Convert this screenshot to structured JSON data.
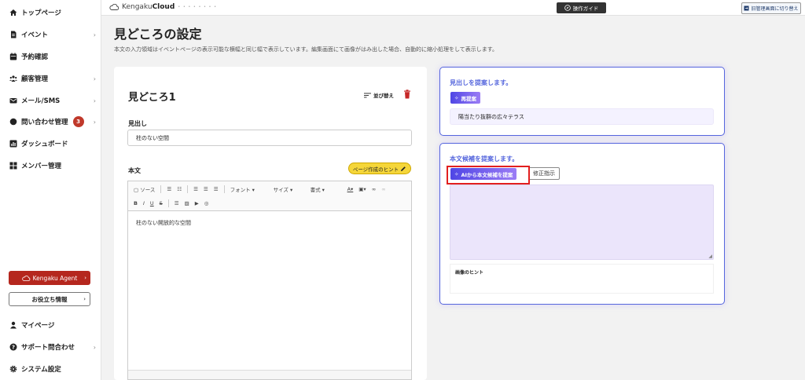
{
  "sidebar": {
    "items": [
      {
        "label": "トップページ",
        "icon": "home-icon"
      },
      {
        "label": "イベント",
        "icon": "document-icon"
      },
      {
        "label": "予約確認",
        "icon": "calendar-icon"
      },
      {
        "label": "顧客管理",
        "icon": "users-icon"
      },
      {
        "label": "メール/SMS",
        "icon": "mail-icon"
      },
      {
        "label": "問い合わせ管理",
        "icon": "chat-icon",
        "badge": "3"
      },
      {
        "label": "ダッシュボード",
        "icon": "chart-icon"
      },
      {
        "label": "メンバー管理",
        "icon": "grid-icon"
      }
    ],
    "agent_label": "Kengaku Agent",
    "info_label": "お役立ち情報",
    "bottom_items": [
      {
        "label": "マイページ",
        "icon": "user-icon"
      },
      {
        "label": "サポート問合わせ",
        "icon": "help-icon"
      },
      {
        "label": "システム設定",
        "icon": "gear-icon"
      }
    ]
  },
  "topbar": {
    "logo_prefix": "Kengaku",
    "logo_suffix": "Cloud",
    "guide_label": "操作ガイド",
    "switch_label": "旧管理画面に切り替え"
  },
  "page": {
    "title": "見どころの設定",
    "description": "本文の入力領域はイベントページの表示可能な横幅と同じ幅で表示しています。編集画面にて画像がはみ出した場合、自動的に縮小処理をして表示します。"
  },
  "card": {
    "title": "見どころ1",
    "sort_label": "並び替え",
    "heading_label": "見出し",
    "heading_value": "柱のない空間",
    "body_label": "本文",
    "hint_label": "ページ作成のヒント",
    "toolbar": {
      "source": "ソース",
      "font": "フォント",
      "size": "サイズ",
      "format": "書式"
    },
    "body_text": "柱のない開放的な空間"
  },
  "suggest_heading": {
    "title": "見出しを提案します。",
    "button": "再提案",
    "result": "陽当たり抜群の広々テラス"
  },
  "suggest_body": {
    "title": "本文候補を提案します。",
    "button": "AIから本文候補を提案",
    "fix_button": "修正指示",
    "image_hint_label": "画像のヒント"
  }
}
